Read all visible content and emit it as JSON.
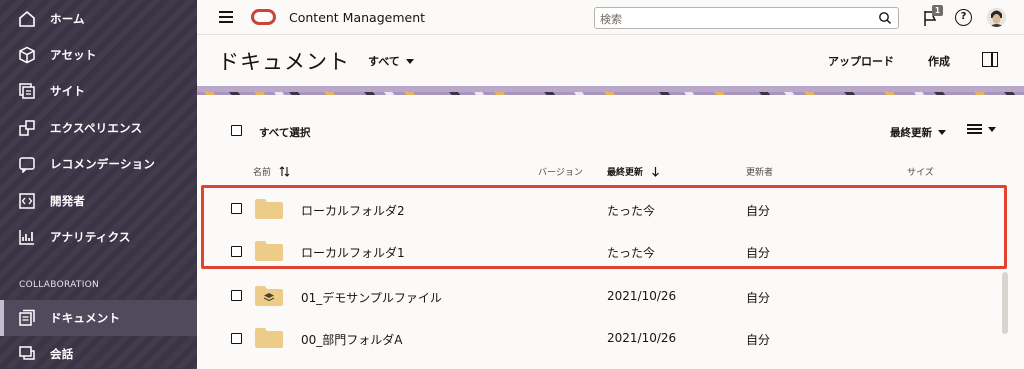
{
  "sidebar": {
    "items": [
      {
        "label": "ホーム",
        "icon": "home-icon"
      },
      {
        "label": "アセット",
        "icon": "cube-icon"
      },
      {
        "label": "サイト",
        "icon": "sites-icon"
      },
      {
        "label": "エクスペリエンス",
        "icon": "experience-icon"
      },
      {
        "label": "レコメンデーション",
        "icon": "recommendation-icon"
      },
      {
        "label": "開発者",
        "icon": "code-icon"
      },
      {
        "label": "アナリティクス",
        "icon": "analytics-icon"
      }
    ],
    "section_label": "COLLABORATION",
    "collab_items": [
      {
        "label": "ドキュメント",
        "icon": "document-icon",
        "active": true
      },
      {
        "label": "会話",
        "icon": "conversation-icon"
      }
    ]
  },
  "topbar": {
    "app_title": "Content Management",
    "search_placeholder": "検索",
    "notification_count": "1"
  },
  "header": {
    "title": "ドキュメント",
    "filter": "すべて",
    "upload": "アップロード",
    "create": "作成"
  },
  "controls": {
    "select_all": "すべて選択",
    "sort_by": "最終更新"
  },
  "columns": {
    "name": "名前",
    "version": "バージョン",
    "updated": "最終更新",
    "updated_by": "更新者",
    "size": "サイズ"
  },
  "rows": [
    {
      "name": "ローカルフォルダ2",
      "updated": "たった今",
      "updated_by": "自分",
      "type": "folder"
    },
    {
      "name": "ローカルフォルダ1",
      "updated": "たった今",
      "updated_by": "自分",
      "type": "folder"
    },
    {
      "name": "01_デモサンプルファイル",
      "updated": "2021/10/26",
      "updated_by": "自分",
      "type": "shared-folder"
    },
    {
      "name": "00_部門フォルダA",
      "updated": "2021/10/26",
      "updated_by": "自分",
      "type": "folder"
    }
  ],
  "colors": {
    "sidebar_bg": "#3d3647",
    "accent": "#c74634",
    "highlight": "#e3422f",
    "folder": "#edcc8a"
  }
}
